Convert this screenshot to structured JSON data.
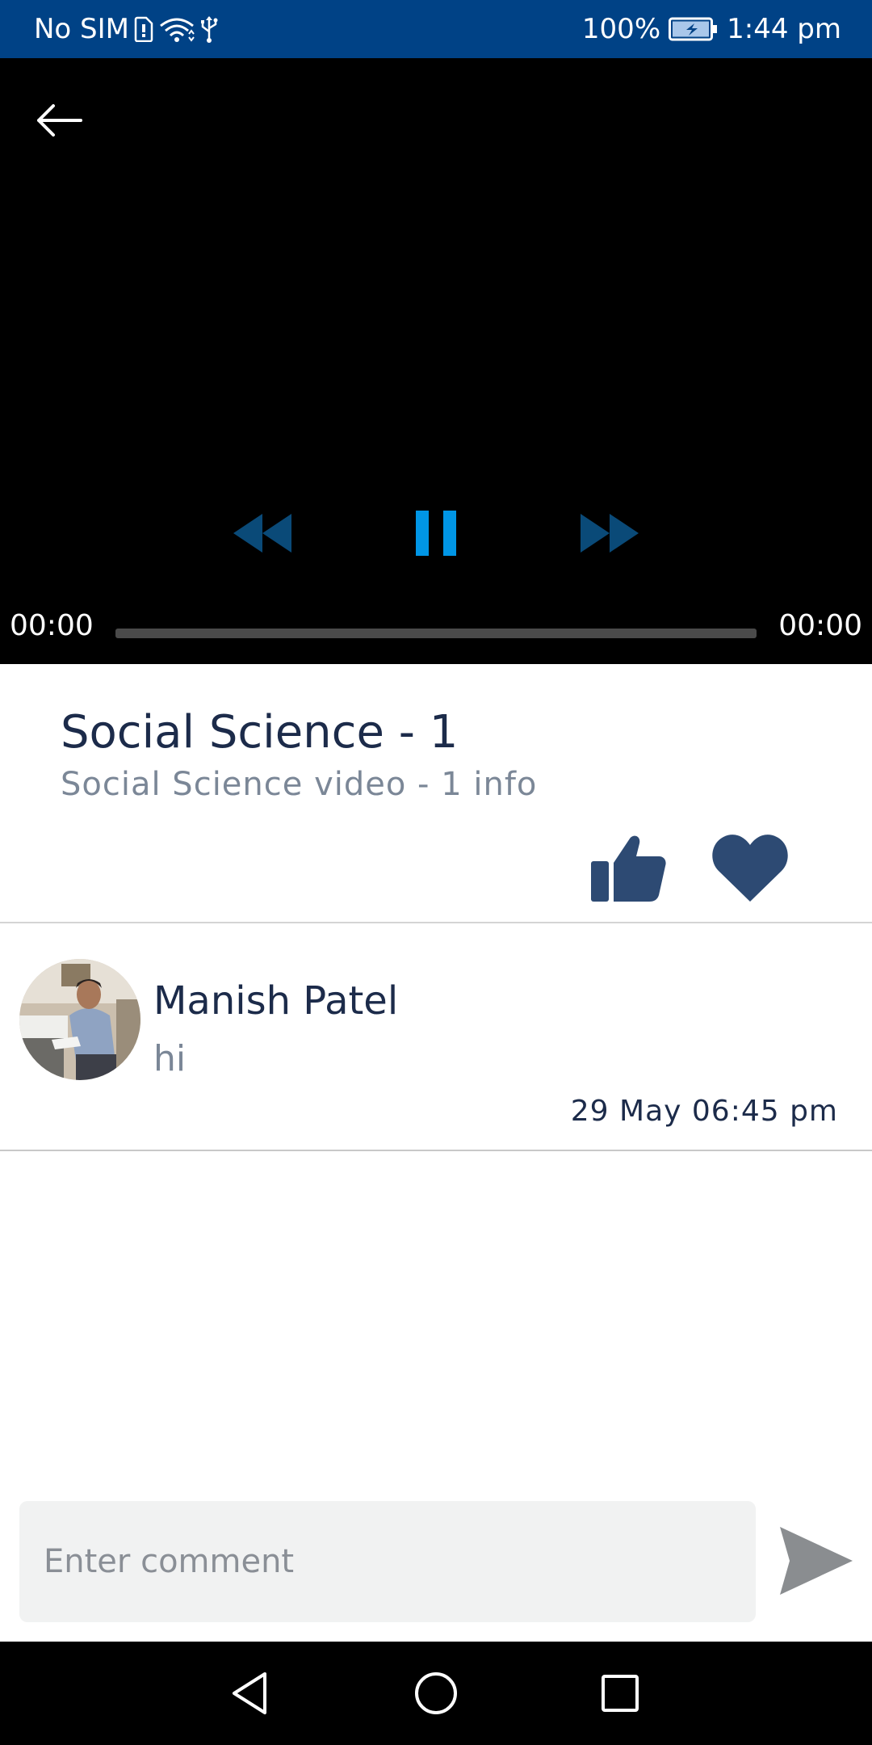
{
  "status_bar": {
    "carrier": "No SIM",
    "battery": "100%",
    "time": "1:44 pm",
    "icons": [
      "sim-card-icon",
      "wifi-icon",
      "usb-icon",
      "battery-charging-icon"
    ]
  },
  "player": {
    "current_time": "00:00",
    "total_time": "00:00",
    "progress": 0,
    "state": "playing",
    "controls": [
      "back-arrow-icon",
      "rewind-icon",
      "pause-icon",
      "fast-forward-icon"
    ],
    "colors": {
      "background": "#000000",
      "accent": "#0096e6",
      "dim_accent": "#0a4a78"
    }
  },
  "video": {
    "title": "Social Science - 1",
    "description": "Social Science video - 1 info"
  },
  "actions": {
    "icons": [
      "thumbs-up-icon",
      "heart-icon"
    ],
    "color": "#2d4a73"
  },
  "comments": [
    {
      "name": "Manish Patel",
      "text": "hi",
      "time": "29 May 06:45 pm"
    }
  ],
  "comment_input": {
    "placeholder": "Enter comment",
    "value": ""
  },
  "send": {
    "icon": "send-icon"
  },
  "nav_bar": {
    "icons": [
      "back-triangle-icon",
      "home-circle-icon",
      "recents-square-icon"
    ]
  },
  "theme": {
    "status_bar": "#004286",
    "title_text": "#1c2b4a",
    "secondary_text": "#7b8797"
  }
}
